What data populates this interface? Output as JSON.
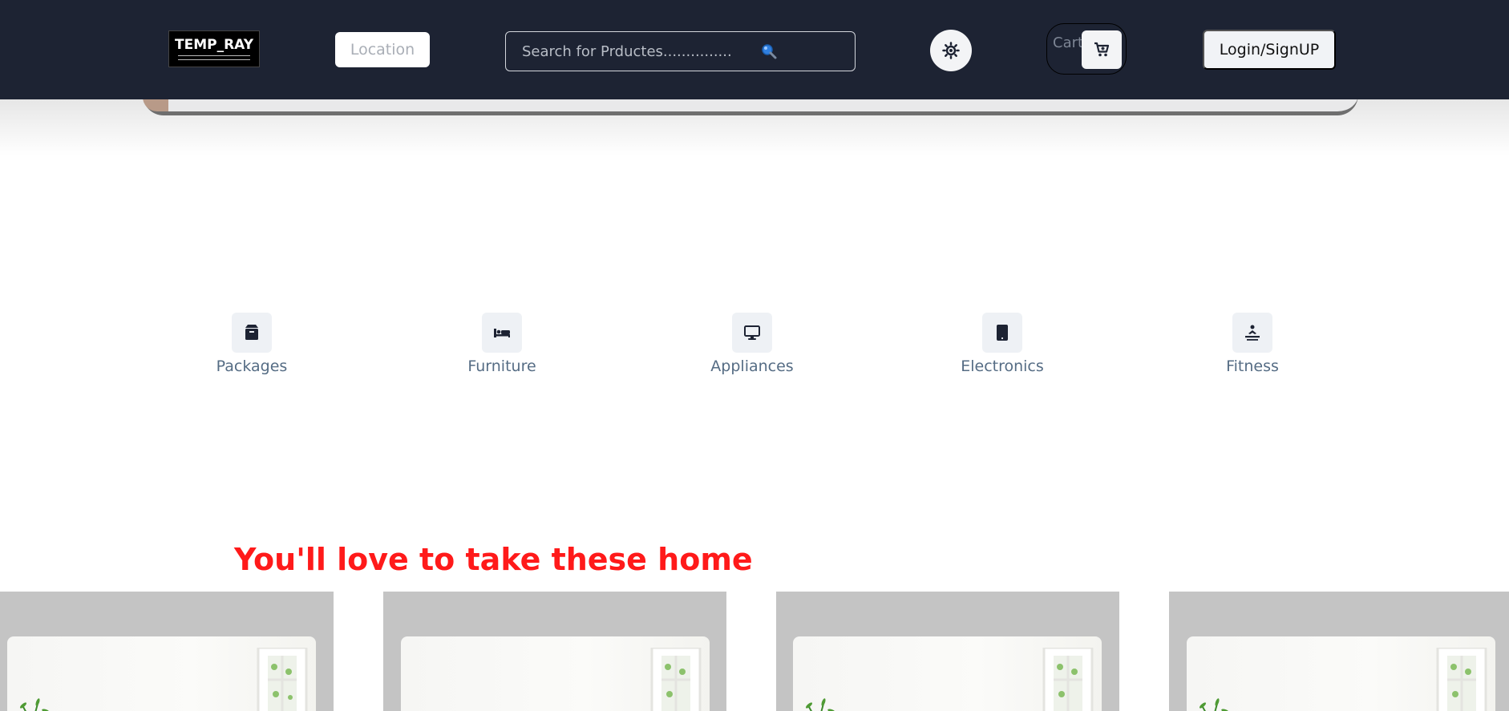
{
  "header": {
    "logo_text": "TEMP_RAY",
    "location_label": "Location",
    "search_placeholder": "Search for Prductes...............",
    "cart_label": "Cart",
    "login_label": "Login/SignUP"
  },
  "categories": [
    {
      "label": "Packages",
      "icon": "package-icon"
    },
    {
      "label": "Furniture",
      "icon": "bed-icon"
    },
    {
      "label": "Appliances",
      "icon": "monitor-icon"
    },
    {
      "label": "Electronics",
      "icon": "tablet-icon"
    },
    {
      "label": "Fitness",
      "icon": "exercise-icon"
    }
  ],
  "section": {
    "heading": "You'll love to take these home"
  },
  "colors": {
    "header_bg": "#1d2333",
    "heading": "#ff1a1a",
    "category_text": "#556c84"
  }
}
